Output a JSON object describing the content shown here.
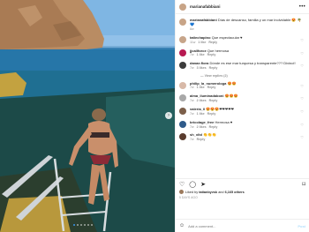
{
  "post": {
    "username": "marianafabbiani",
    "caption": "Días de descanso, familia y un mar inolvidable 😍 🌴 💙",
    "caption_time": "8w",
    "like_count_text": "Liked by",
    "liked_by_user": "tatianbyvsk",
    "likes_and": "and",
    "likes_others": "6,165 others",
    "date": "5 DAYS AGO",
    "add_comment_placeholder": "Add a comment...",
    "post_label": "Post",
    "more_label": "•••"
  },
  "comments": [
    {
      "user": "tatiechapino",
      "text": "Que espectacular ♥",
      "time": "11w",
      "likes": "1 like",
      "reply": "Reply",
      "color": "#c7a58a"
    },
    {
      "user": "jjcallforce",
      "text": "Que hermosa",
      "time": "7w",
      "likes": "1 like",
      "reply": "Reply",
      "color": "#b81a52"
    },
    {
      "user": "danae.flora",
      "text": "Dónde es ese mar turquesa y transparente??? Divino!!",
      "time": "7w",
      "likes": "3 likes",
      "reply": "Reply",
      "color": "#3c3c3c"
    },
    {
      "user": "philip_la_numerologa",
      "text": "😍😍",
      "time": "7w",
      "likes": "1 like",
      "reply": "Reply",
      "color": "#d8b9a8"
    },
    {
      "user": "alma_iluminadaboni",
      "text": "😍😍😍",
      "time": "7w",
      "likes": "2 likes",
      "reply": "Reply",
      "color": "#a8a8a8"
    },
    {
      "user": "valeria_ll",
      "text": "😍😍😍❤❤❤❤❤",
      "time": "7w",
      "likes": "1 like",
      "reply": "Reply",
      "color": "#7c5f4a"
    },
    {
      "user": "bricolage_free",
      "text": "Hermosa ♥",
      "time": "7w",
      "likes": "2 likes",
      "reply": "Reply",
      "color": "#2f5b8a"
    },
    {
      "user": "sh_xltd",
      "text": "👏👏👏",
      "time": "7w",
      "likes": "",
      "reply": "Reply",
      "color": "#5a3c2e"
    }
  ],
  "view_replies": "— View replies (2)",
  "icons": {
    "like": "heart-icon",
    "comment": "comment-icon",
    "share": "share-icon",
    "save": "bookmark-icon",
    "emoji": "smile-icon",
    "next": "chevron-right-icon"
  }
}
